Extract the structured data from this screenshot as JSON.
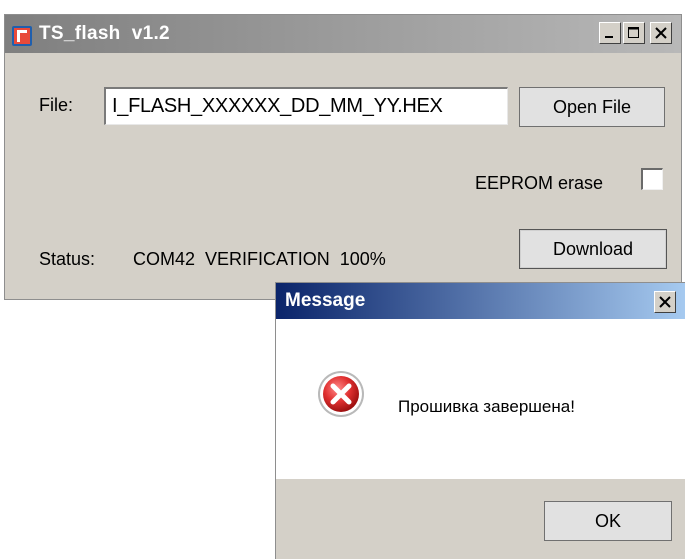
{
  "main_window": {
    "title": "TS_flash  v1.2",
    "file_label": "File:",
    "file_value": "I_FLASH_XXXXXX_DD_MM_YY.HEX",
    "open_button": "Open File",
    "eeprom_label": "EEPROM erase",
    "eeprom_checked": false,
    "status_label": "Status:",
    "status_value": "COM42  VERIFICATION  100%",
    "download_button": "Download",
    "icons": [
      "app-icon",
      "minimize-icon",
      "maximize-icon",
      "close-icon"
    ]
  },
  "message_dialog": {
    "title": "Message",
    "text": "Прошивка завершена!",
    "ok_button": "OK",
    "icons": [
      "error-icon",
      "close-icon"
    ]
  },
  "colors": {
    "window_bg": "#d4d0c8",
    "main_titlebar": "#7f7f7f",
    "dialog_titlebar": "#0a246a",
    "error_red": "#d92b2b"
  }
}
